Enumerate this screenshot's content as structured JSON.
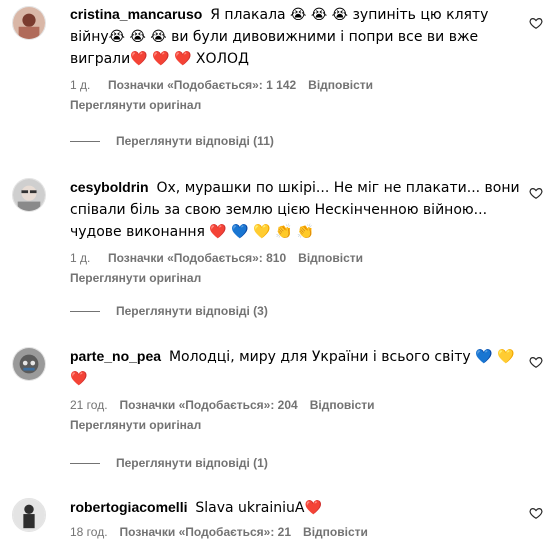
{
  "comments": [
    {
      "username": "cristina_mancaruso",
      "text": "Я плакала 😭 😭 😭 зупиніть цю кляту війну😭 😭 😭 ви були дивовижними і попри все ви вже виграли❤️ ❤️ ❤️ ХОЛОД",
      "time": "1 д.",
      "likes": "Позначки «Подобається»: 1 142",
      "reply": "Відповісти",
      "see_original": "Переглянути оригінал",
      "view_replies": "Переглянути відповіді (11)"
    },
    {
      "username": "cesyboldrin",
      "text": "Ох, мурашки по шкірі... Не міг не плакати... вони співали біль за свою землю цією Нескінченною війною... чудове виконання ❤️ 💙 💛 👏 👏",
      "time": "1 д.",
      "likes": "Позначки «Подобається»: 810",
      "reply": "Відповісти",
      "see_original": "Переглянути оригінал",
      "view_replies": "Переглянути відповіді (3)"
    },
    {
      "username": "parte_no_pea",
      "text": "Молодці, миру для України і всього світу 💙 💛 ❤️",
      "time": "21 год.",
      "likes": "Позначки «Подобається»: 204",
      "reply": "Відповісти",
      "see_original": "Переглянути оригінал",
      "view_replies": "Переглянути відповіді (1)"
    },
    {
      "username": "robertogiacomelli",
      "text": "Slava ukrainiuA❤️",
      "time": "18 год.",
      "likes": "Позначки «Подобається»: 21",
      "reply": "Відповісти"
    }
  ],
  "icons": {
    "like": "heart-outline-icon"
  },
  "colors": {
    "secondary_text": "#737373",
    "primary_text": "#000000"
  }
}
